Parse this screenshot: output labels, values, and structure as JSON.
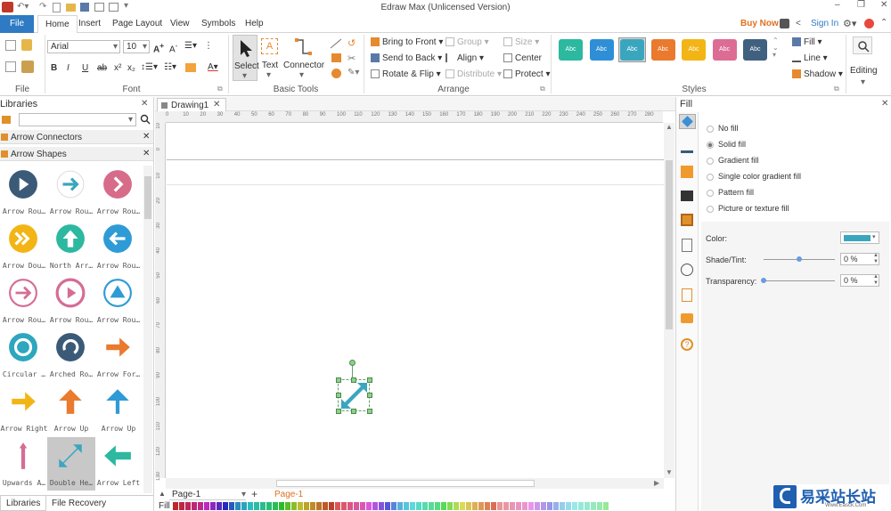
{
  "window": {
    "title": "Edraw Max (Unlicensed Version)"
  },
  "menu": {
    "file": "File",
    "tabs": [
      "Home",
      "Insert",
      "Page Layout",
      "View",
      "Symbols",
      "Help"
    ],
    "buy_now": "Buy Now",
    "sign_in": "Sign In"
  },
  "ribbon": {
    "groups": {
      "file": "File",
      "font": "Font",
      "basic_tools": "Basic Tools",
      "arrange": "Arrange",
      "styles": "Styles"
    },
    "font_name": "Arial",
    "font_size": "10",
    "tools": {
      "select": "Select",
      "text": "Text",
      "connector": "Connector"
    },
    "arrange": {
      "bring_front": "Bring to Front",
      "send_back": "Send to Back",
      "rotate_flip": "Rotate & Flip",
      "group": "Group",
      "align": "Align",
      "distribute": "Distribute",
      "size": "Size",
      "center": "Center",
      "protect": "Protect"
    },
    "style_swatches": [
      {
        "label": "Abc",
        "color": "#2db8a0"
      },
      {
        "label": "Abc",
        "color": "#2e8fd6"
      },
      {
        "label": "Abc",
        "color": "#3aa6be"
      },
      {
        "label": "Abc",
        "color": "#e97a2e"
      },
      {
        "label": "Abc",
        "color": "#f3b515"
      },
      {
        "label": "Abc",
        "color": "#dd6c95"
      },
      {
        "label": "Abc",
        "color": "#40607f"
      }
    ],
    "fill": "Fill",
    "line": "Line",
    "shadow": "Shadow",
    "editing": "Editing"
  },
  "libraries": {
    "title": "Libraries",
    "sections": [
      "Arrow Connectors",
      "Arrow Shapes"
    ],
    "shapes": [
      {
        "label": "Arrow Rou…",
        "color": "#3a5a78"
      },
      {
        "label": "Arrow Rou…",
        "color": "#3aa6be"
      },
      {
        "label": "Arrow Rou…",
        "color": "#d66c8a"
      },
      {
        "label": "Arrow Dou…",
        "color": "#f3b515"
      },
      {
        "label": "North Arr…",
        "color": "#2db8a0"
      },
      {
        "label": "Arrow Rou…",
        "color": "#2e9bd6"
      },
      {
        "label": "Arrow Rou…",
        "color": "#d66c95"
      },
      {
        "label": "Arrow Rou…",
        "color": "#d66c95"
      },
      {
        "label": "Arrow Rou…",
        "color": "#2e9bd6"
      },
      {
        "label": "Circular …",
        "color": "#2ea6be"
      },
      {
        "label": "Arched Ro…",
        "color": "#3a5a78"
      },
      {
        "label": "Arrow For…",
        "color": "#e97a2e"
      },
      {
        "label": "Arrow Right",
        "color": "#f3b515"
      },
      {
        "label": "Arrow Up",
        "color": "#e97a2e"
      },
      {
        "label": "Arrow Up",
        "color": "#2e9bd6"
      },
      {
        "label": "Upwards A…",
        "color": "#d66c95"
      },
      {
        "label": "Double He…",
        "color": "#3aa6be"
      },
      {
        "label": "Arrow Left",
        "color": "#2db8a0"
      }
    ],
    "bottom_tabs": [
      "Libraries",
      "File Recovery"
    ]
  },
  "document": {
    "tab": "Drawing1",
    "page_select": "Page-1",
    "page_tab": "Page-1",
    "fill_label": "Fill",
    "ruler_h": [
      "0",
      "10",
      "20",
      "30",
      "40",
      "50",
      "60",
      "70",
      "80",
      "90",
      "100",
      "110",
      "120",
      "130",
      "140",
      "150",
      "160",
      "170",
      "180",
      "190",
      "200",
      "210",
      "220",
      "230",
      "240",
      "250",
      "260",
      "270",
      "280"
    ],
    "ruler_v": [
      "10",
      "0",
      "10",
      "20",
      "30",
      "40",
      "50",
      "60",
      "70",
      "80",
      "90",
      "100",
      "110",
      "120",
      "130"
    ]
  },
  "fill_panel": {
    "title": "Fill",
    "options": [
      "No fill",
      "Solid fill",
      "Gradient fill",
      "Single color gradient fill",
      "Pattern fill",
      "Picture or texture fill"
    ],
    "selected": "Solid fill",
    "color_label": "Color:",
    "color_value": "#3aa6be",
    "shade_label": "Shade/Tint:",
    "shade_value": "0 %",
    "transparency_label": "Transparency:",
    "transparency_value": "0 %"
  },
  "watermark": {
    "text": "易采站长站",
    "sub": "Www.Easck.Com"
  }
}
